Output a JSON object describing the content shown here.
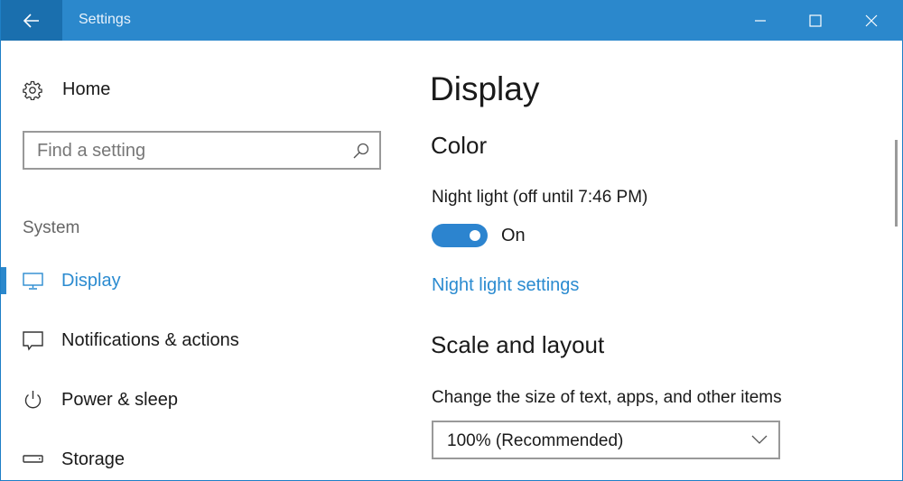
{
  "window": {
    "title": "Settings",
    "accent_color": "#2b88cc",
    "controls": {
      "back": "back-arrow-icon",
      "minimize": "minimize-icon",
      "maximize": "maximize-icon",
      "close": "close-icon"
    }
  },
  "sidebar": {
    "home_label": "Home",
    "search_placeholder": "Find a setting",
    "section_label": "System",
    "items": [
      {
        "label": "Display",
        "icon": "monitor-icon",
        "active": true
      },
      {
        "label": "Notifications & actions",
        "icon": "notification-icon",
        "active": false
      },
      {
        "label": "Power & sleep",
        "icon": "power-icon",
        "active": false
      },
      {
        "label": "Storage",
        "icon": "storage-icon",
        "active": false
      }
    ]
  },
  "main": {
    "page_title": "Display",
    "color_section": {
      "heading": "Color",
      "night_light_label": "Night light (off until 7:46 PM)",
      "toggle_state": "On",
      "toggle_on": true,
      "link_label": "Night light settings"
    },
    "scale_section": {
      "heading": "Scale and layout",
      "size_label": "Change the size of text, apps, and other items",
      "size_selected": "100% (Recommended)"
    }
  }
}
